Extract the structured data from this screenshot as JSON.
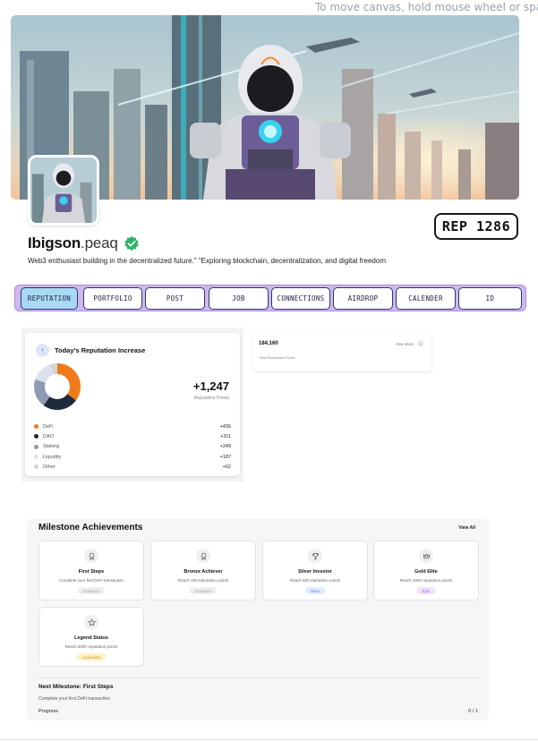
{
  "canvas_hint": "To move canvas, hold mouse wheel or spacebar",
  "profile": {
    "username": "Ibigson",
    "domain": ".peaq",
    "bio": "Web3 enthusiast building in the decentralized future.\" \"Exploring blockchain, decentralization, and digital freedom",
    "rep_badge": "REP 1286"
  },
  "tabs": [
    {
      "label": "REPUTATION",
      "active": true
    },
    {
      "label": "PORTFOLIO"
    },
    {
      "label": "POST"
    },
    {
      "label": "JOB"
    },
    {
      "label": "CONNECTIONS"
    },
    {
      "label": "AIRDROP"
    },
    {
      "label": "CALENDER"
    },
    {
      "label": "ID"
    }
  ],
  "reputation": {
    "title": "Today's Reputation Increase",
    "total": "+1,247",
    "total_label": "Reputation Points",
    "breakdown": [
      {
        "label": "DeFi",
        "value": "+436",
        "points": 436,
        "color": "#f07a1a"
      },
      {
        "label": "DAO",
        "value": "+311",
        "points": 311,
        "color": "#1f2a3c"
      },
      {
        "label": "Staking",
        "value": "+249",
        "points": 249,
        "color": "#8f9bb3"
      },
      {
        "label": "Liquidity",
        "value": "+187",
        "points": 187,
        "color": "#dbe2ee"
      },
      {
        "label": "Other",
        "value": "+62",
        "points": 62,
        "color": "#d4d4d4"
      }
    ]
  },
  "score_card": {
    "value": "184,160",
    "label": "Total Reputation Score",
    "see_more": "See More"
  },
  "milestones": {
    "title": "Milestone Achievements",
    "view_all": "View All",
    "items": [
      {
        "name": "First Steps",
        "desc": "Complete your first DeFi transaction",
        "tag": "Common",
        "icon": "medal-icon",
        "tag_bg": "#eeeeee",
        "tag_fg": "#9a9a9a"
      },
      {
        "name": "Bronze Achiever",
        "desc": "Reach 100 reputation points",
        "tag": "Common",
        "icon": "medal-icon",
        "tag_bg": "#eeeeee",
        "tag_fg": "#9a9a9a"
      },
      {
        "name": "Silver Investor",
        "desc": "Reach 500 reputation points",
        "tag": "Rare",
        "icon": "trophy-icon",
        "tag_bg": "#dfeafc",
        "tag_fg": "#5a86d8"
      },
      {
        "name": "Gold Elite",
        "desc": "Reach 1000 reputation points",
        "tag": "Epic",
        "icon": "crown-icon",
        "tag_bg": "#f0e2fb",
        "tag_fg": "#a36ad6"
      },
      {
        "name": "Legend Status",
        "desc": "Reach 5000 reputation points",
        "tag": "Legendary",
        "icon": "star-icon",
        "tag_bg": "#fdf1c7",
        "tag_fg": "#d79b12"
      }
    ],
    "next_title": "Next Milestone: First Steps",
    "next_desc": "Complete your first DeFi transaction",
    "progress_label": "Progress",
    "progress_value": "0 / 1"
  }
}
